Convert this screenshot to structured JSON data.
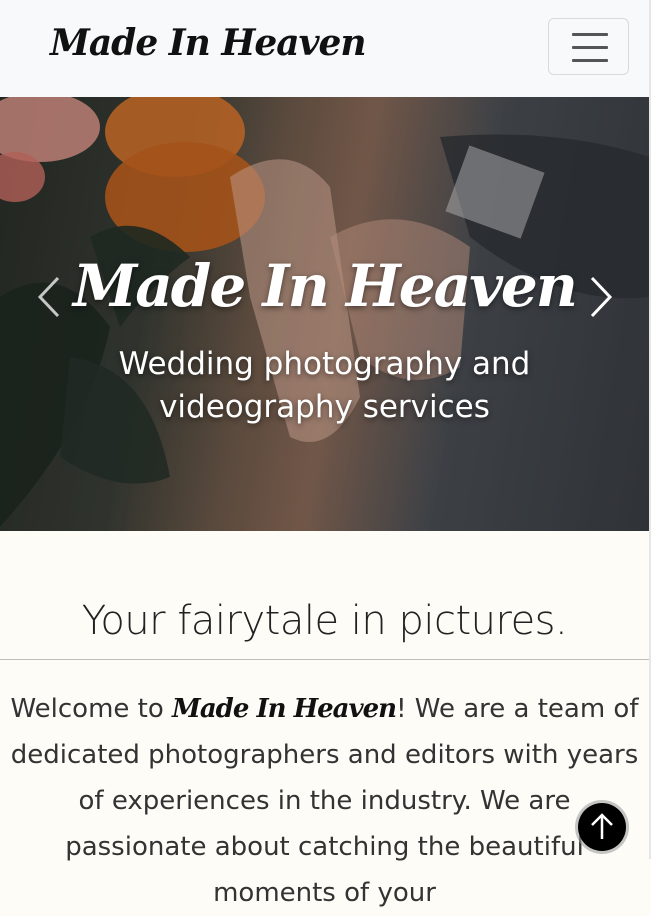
{
  "navbar": {
    "brand": "Made In Heaven",
    "toggle_icon": "hamburger-menu-icon"
  },
  "hero": {
    "title": "Made In Heaven",
    "subtitle": "Wedding photography and videography services",
    "prev_icon": "chevron-left-icon",
    "next_icon": "chevron-right-icon"
  },
  "about": {
    "heading": "Your fairytale in pictures.",
    "intro_before": "Welcome to ",
    "intro_brand": "Made In Heaven",
    "intro_after": "! We are a team of dedicated photographers and editors with years of experiences in the industry. We are passionate about catching the beautiful moments of your"
  },
  "back_to_top": {
    "icon": "arrow-up-icon"
  },
  "colors": {
    "navbar_bg": "#f8f9fa",
    "page_bg": "#fdfcf7",
    "text": "#333333",
    "hero_text": "#ffffff"
  }
}
